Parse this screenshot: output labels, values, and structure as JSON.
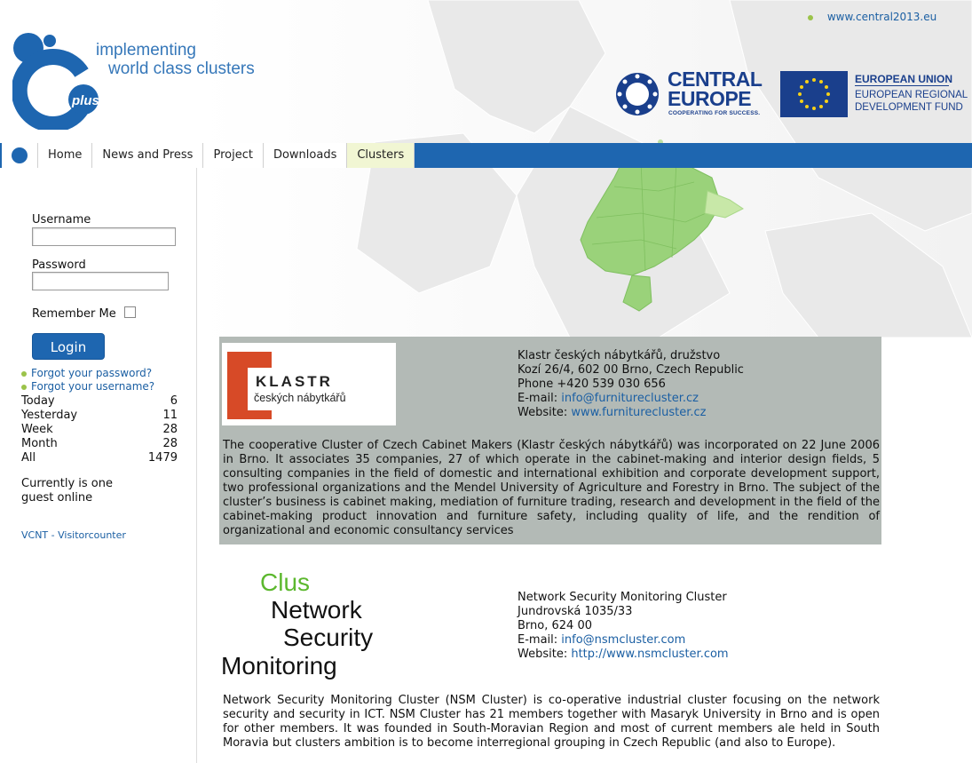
{
  "header": {
    "top_link": "www.central2013.eu",
    "logo_plus": "plus",
    "logo_line1": "implementing",
    "logo_line2": "world class clusters",
    "ce_line1": "CENTRAL",
    "ce_line2": "EUROPE",
    "ce_tagline": "COOPERATING FOR SUCCESS.",
    "eu_line1": "EUROPEAN UNION",
    "eu_line2": "EUROPEAN REGIONAL",
    "eu_line3": "DEVELOPMENT FUND"
  },
  "nav": {
    "tabs": [
      {
        "label": "Home"
      },
      {
        "label": "News and Press"
      },
      {
        "label": "Project"
      },
      {
        "label": "Downloads"
      },
      {
        "label": "Clusters",
        "active": true
      }
    ]
  },
  "login": {
    "username_label": "Username",
    "username_value": "",
    "password_label": "Password",
    "password_value": "",
    "remember_label": "Remember Me",
    "remember_checked": false,
    "button_label": "Login",
    "forgot_password": "Forgot your password?",
    "forgot_username": "Forgot your username?"
  },
  "stats": [
    {
      "label": "Today",
      "value": "6"
    },
    {
      "label": "Yesterday",
      "value": "11"
    },
    {
      "label": "Week",
      "value": "28"
    },
    {
      "label": "Month",
      "value": "28"
    },
    {
      "label": "All",
      "value": "1479"
    }
  ],
  "online_text_1": "Currently is one",
  "online_text_2": "guest online",
  "vcnt_link": "VCNT - Visitorcounter",
  "clusters": [
    {
      "logo_title": "KLASTR",
      "logo_sub": "českých nábytkářů",
      "name": "Klastr českých nábytkářů, družstvo",
      "address": "Kozí 26/4, 602 00 Brno, Czech Republic",
      "phone": "Phone +420 539 030 656",
      "email_label": "E-mail:",
      "email": "info@furniturecluster.cz",
      "website_label": "Website:",
      "website": "www.furniturecluster.cz",
      "description": "The cooperative Cluster of Czech Cabinet Makers (Klastr českých nábytkářů) was incorporated on 22 June 2006 in Brno. It associates 35 companies, 27 of which operate in the cabinet-making and interior design fields, 5 consulting companies in the field of domestic and international exhibition and corporate development support, two professional organizations and the Mendel University of Agriculture and Forestry in Brno. The subject of the cluster’s business is cabinet making, mediation of furniture trading, research and development in the field of the cabinet-making product innovation and furniture safety, including quality of life, and the rendition of organizational and economic consultancy services"
    },
    {
      "logo_words": [
        "Clus",
        "Network",
        "Security",
        "Monitoring"
      ],
      "name": "Network Security Monitoring Cluster",
      "address1": "Jundrovská 1035/33",
      "address2": "Brno, 624 00",
      "email_label": "E-mail:",
      "email": "info@nsmcluster.com",
      "website_label": "Website:",
      "website": "http://www.nsmcluster.com",
      "description": "Network Security Monitoring Cluster (NSM Cluster) is co-operative industrial cluster focusing on the network security and security in ICT. NSM Cluster has 21 members together with Masaryk University in Brno and is open for other members. It was founded in South-Moravian Region and most of current members ale held in South Moravia but clusters ambition is to become interregional grouping in Czech Republic (and also to Europe)."
    }
  ],
  "colors": {
    "nav_blue": "#1e66b0",
    "link_blue": "#1b5fa3",
    "map_green": "#9ad27a",
    "entry_gray": "#b3bab6",
    "klastr_red": "#d74a27",
    "nsm_green": "#5cb82e"
  }
}
